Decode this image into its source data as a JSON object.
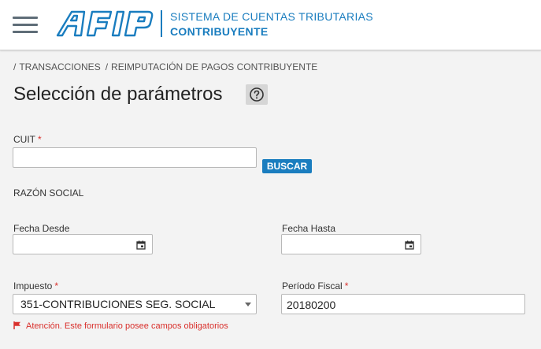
{
  "header": {
    "logo_text": "AFIP",
    "system_name": "SISTEMA DE CUENTAS TRIBUTARIAS",
    "role": "CONTRIBUYENTE"
  },
  "breadcrumb": {
    "items": [
      "TRANSACCIONES",
      "REIMPUTACIÓN DE PAGOS CONTRIBUYENTE"
    ]
  },
  "page": {
    "title": "Selección de parámetros"
  },
  "form": {
    "cuit": {
      "label": "CUIT",
      "required_mark": "*",
      "value": ""
    },
    "buscar_label": "BUSCAR",
    "razon_social_label": "RAZÓN SOCIAL",
    "fecha_desde": {
      "label": "Fecha Desde",
      "value": ""
    },
    "fecha_hasta": {
      "label": "Fecha Hasta",
      "value": ""
    },
    "impuesto": {
      "label": "Impuesto",
      "required_mark": "*",
      "selected": "351-CONTRIBUCIONES SEG. SOCIAL"
    },
    "periodo_fiscal": {
      "label": "Período Fiscal",
      "required_mark": "*",
      "value": "20180200"
    },
    "warning": "Atención. Este formulario posee campos obligatorios"
  },
  "colors": {
    "brand_blue": "#1a7dbf",
    "required_red": "#d9302c"
  }
}
